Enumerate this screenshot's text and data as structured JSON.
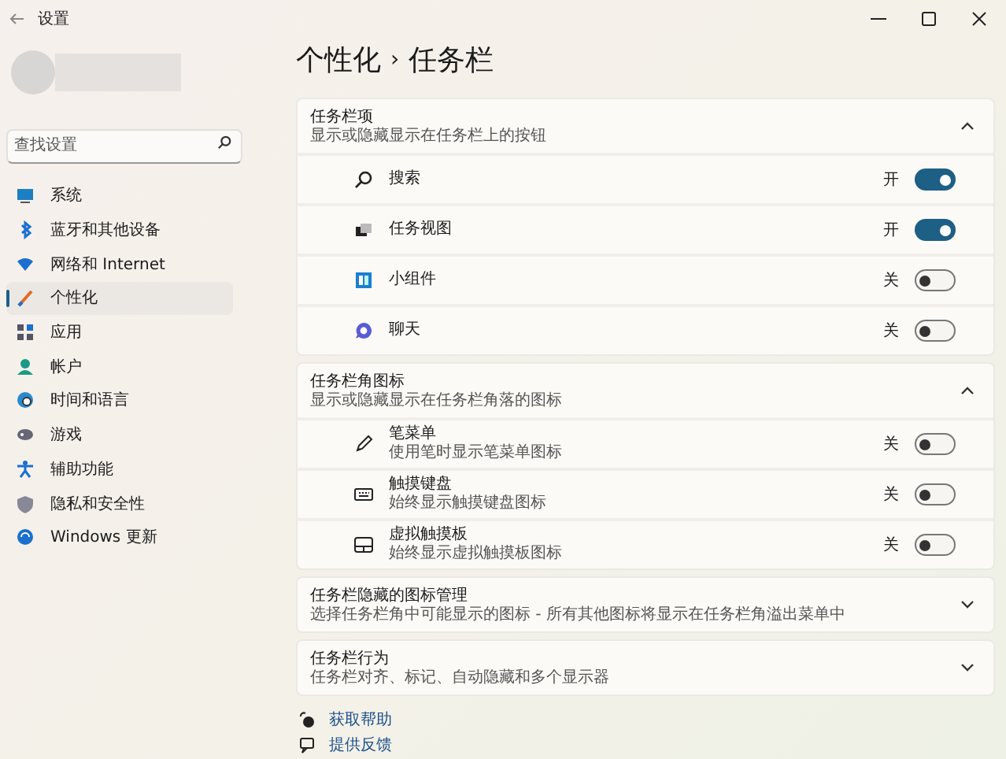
{
  "window": {
    "title": "设置"
  },
  "sidebar": {
    "search": {
      "placeholder": "查找设置"
    },
    "items": [
      {
        "label": "系统",
        "selected": false
      },
      {
        "label": "蓝牙和其他设备",
        "selected": false
      },
      {
        "label": "网络和 Internet",
        "selected": false
      },
      {
        "label": "个性化",
        "selected": true
      },
      {
        "label": "应用",
        "selected": false
      },
      {
        "label": "帐户",
        "selected": false
      },
      {
        "label": "时间和语言",
        "selected": false
      },
      {
        "label": "游戏",
        "selected": false
      },
      {
        "label": "辅助功能",
        "selected": false
      },
      {
        "label": "隐私和安全性",
        "selected": false
      },
      {
        "label": "Windows 更新",
        "selected": false
      }
    ]
  },
  "breadcrumb": {
    "parent": "个性化",
    "separator": "›",
    "current": "任务栏"
  },
  "sections": [
    {
      "title": "任务栏项",
      "subtitle": "显示或隐藏显示在任务栏上的按钮",
      "expanded": true,
      "rows": [
        {
          "label": "搜索",
          "state_label": "开",
          "on": true
        },
        {
          "label": "任务视图",
          "state_label": "开",
          "on": true
        },
        {
          "label": "小组件",
          "state_label": "关",
          "on": false
        },
        {
          "label": "聊天",
          "state_label": "关",
          "on": false
        }
      ]
    },
    {
      "title": "任务栏角图标",
      "subtitle": "显示或隐藏显示在任务栏角落的图标",
      "expanded": true,
      "rows": [
        {
          "label": "笔菜单",
          "description": "使用笔时显示笔菜单图标",
          "state_label": "关",
          "on": false
        },
        {
          "label": "触摸键盘",
          "description": "始终显示触摸键盘图标",
          "state_label": "关",
          "on": false
        },
        {
          "label": "虚拟触摸板",
          "description": "始终显示虚拟触摸板图标",
          "state_label": "关",
          "on": false
        }
      ]
    },
    {
      "title": "任务栏隐藏的图标管理",
      "subtitle": "选择任务栏角中可能显示的图标 - 所有其他图标将显示在任务栏角溢出菜单中",
      "expanded": false
    },
    {
      "title": "任务栏行为",
      "subtitle": "任务栏对齐、标记、自动隐藏和多个显示器",
      "expanded": false
    }
  ],
  "links": [
    "获取帮助",
    "提供反馈"
  ]
}
